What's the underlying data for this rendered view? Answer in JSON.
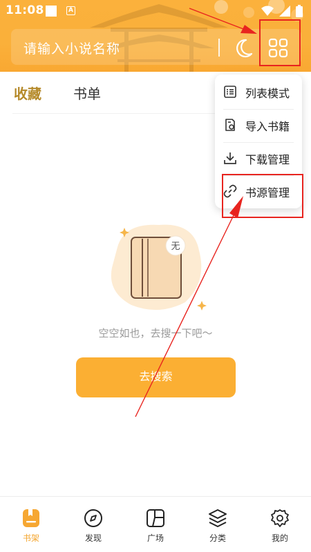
{
  "status_bar": {
    "time": "11:08",
    "badge_letter": "A"
  },
  "search": {
    "placeholder": "请输入小说名称"
  },
  "tabs": [
    {
      "label": "收藏",
      "active": true
    },
    {
      "label": "书单",
      "active": false
    }
  ],
  "menu": {
    "items": [
      {
        "label": "列表模式",
        "icon": "list-icon"
      },
      {
        "label": "导入书籍",
        "icon": "import-icon"
      },
      {
        "label": "下载管理",
        "icon": "download-icon"
      },
      {
        "label": "书源管理",
        "icon": "link-icon"
      }
    ]
  },
  "empty_state": {
    "badge": "无",
    "message": "空空如也，去搜一下吧～",
    "button_label": "去搜索"
  },
  "bottom_nav": [
    {
      "label": "书架",
      "icon": "bookshelf-icon",
      "active": true
    },
    {
      "label": "发现",
      "icon": "compass-icon",
      "active": false
    },
    {
      "label": "广场",
      "icon": "square-icon",
      "active": false
    },
    {
      "label": "分类",
      "icon": "layers-icon",
      "active": false
    },
    {
      "label": "我的",
      "icon": "settings-icon",
      "active": false
    }
  ],
  "colors": {
    "accent": "#fbaf33",
    "tab_active": "#b58a2a",
    "annotation": "#e8241f"
  }
}
